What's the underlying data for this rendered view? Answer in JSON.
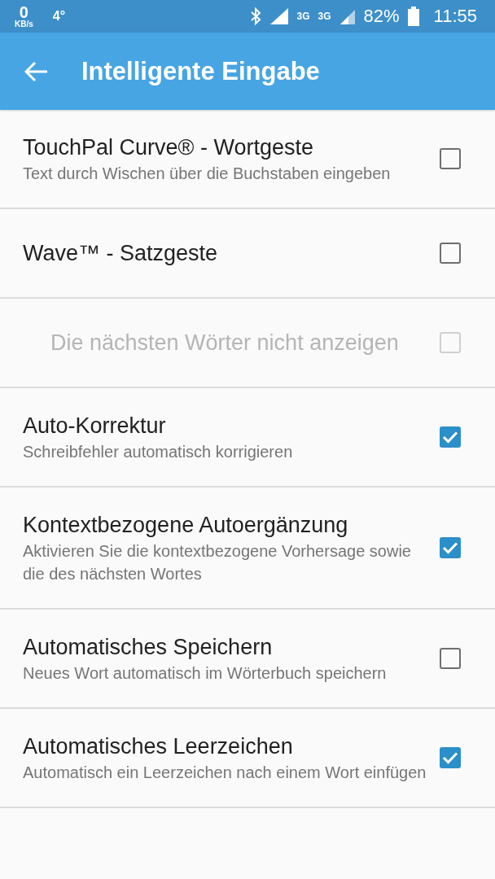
{
  "status_bar": {
    "speed": "0",
    "speed_unit": "KB/s",
    "temperature": "4°",
    "network_1": "3G",
    "network_2": "3G",
    "battery": "82%",
    "time": "11:55"
  },
  "app_bar": {
    "title": "Intelligente Eingabe"
  },
  "settings": [
    {
      "title": "TouchPal Curve® - Wortgeste",
      "subtitle": "Text durch Wischen über die Buchstaben eingeben",
      "checked": false,
      "disabled": false
    },
    {
      "title": "Wave™ - Satzgeste",
      "checked": false,
      "disabled": false,
      "children": [
        {
          "title": "Die nächsten Wörter nicht anzeigen",
          "checked": false,
          "disabled": true
        }
      ]
    },
    {
      "title": "Auto-Korrektur",
      "subtitle": "Schreibfehler automatisch korrigieren",
      "checked": true,
      "disabled": false
    },
    {
      "title": "Kontextbezogene Autoergänzung",
      "subtitle": "Aktivieren Sie die kontextbezogene Vorhersage sowie die des nächsten Wortes",
      "checked": true,
      "disabled": false
    },
    {
      "title": "Automatisches Speichern",
      "subtitle": "Neues Wort automatisch im Wörterbuch speichern",
      "checked": false,
      "disabled": false
    },
    {
      "title": "Automatisches Leerzeichen",
      "subtitle": "Automatisch ein Leerzeichen nach einem Wort einfügen",
      "checked": true,
      "disabled": false
    }
  ]
}
